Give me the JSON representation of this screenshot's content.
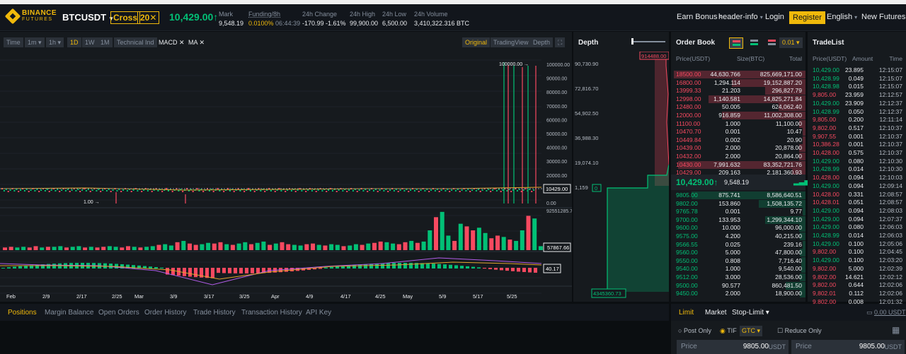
{
  "header": {
    "brand_line1": "BINANCE",
    "brand_line2": "FUTURES",
    "symbol": "BTCUSDT",
    "margin_mode": "Cross",
    "leverage": "20✕",
    "last_price": "10,429.00↑",
    "mark_label": "Mark",
    "mark_value": "9,548.19",
    "funding_label": "Funding/8h",
    "funding_rate": "0.0100%",
    "funding_countdown": "06:44:39",
    "change_label": "24h Change",
    "change_value": "-170.99 -1.61%",
    "high_label": "24h High",
    "high_value": "99,900.00",
    "low_label": "24h Low",
    "low_value": "6,500.00",
    "volume_label": "24h Volume",
    "volume_value": "3,410,322.316 BTC",
    "earn_bonus": "Earn Bonus",
    "header_info": "header-info",
    "login": "Login",
    "register": "Register",
    "language": "English",
    "new_futures": "New Futures"
  },
  "chart": {
    "intervals": [
      "Time",
      "1m",
      "1h",
      "1D",
      "1W",
      "1M",
      "Technical Ind",
      "MACD",
      "MA"
    ],
    "selected_interval": "1D",
    "views": [
      "Original",
      "TradingView",
      "Depth"
    ],
    "selected_view": "Original",
    "price_axis": [
      "100000.00",
      "90000.00",
      "80000.00",
      "70000.00",
      "60000.00",
      "50000.00",
      "40000.00",
      "30000.00",
      "20000.00",
      "10000.00",
      "0.00"
    ],
    "max_marker": "100000.00",
    "min_marker": "1.00",
    "current_price_tag": "10429.00",
    "vol_axis_top": "92551285.71",
    "vol_tag": "57867.66",
    "macd_tag": "40.17",
    "x_axis": [
      "Feb",
      "2/9",
      "2/17",
      "2/25",
      "Mar",
      "3/9",
      "3/17",
      "3/25",
      "Apr",
      "4/9",
      "4/17",
      "4/25",
      "May",
      "5/9",
      "5/17",
      "5/25"
    ],
    "colors": {
      "up": "#02c076",
      "down": "#f84960",
      "ma": "#e0a32c",
      "macd": "#b15ce8"
    }
  },
  "chart_data": {
    "type": "bar",
    "series": [
      {
        "name": "Volume",
        "values": [
          4,
          5,
          4,
          5,
          4,
          6,
          4,
          5,
          5,
          6,
          4,
          5,
          6,
          4,
          5,
          4,
          5,
          6,
          5,
          4,
          6,
          5,
          4,
          5,
          6,
          8,
          9,
          7,
          12,
          14,
          10,
          8,
          9,
          11,
          10,
          12,
          9,
          8,
          10,
          12,
          9,
          11,
          13,
          8,
          10,
          12,
          9,
          8,
          7,
          9,
          10,
          8,
          7,
          9,
          8,
          6,
          7,
          9,
          8,
          10,
          11,
          13,
          12,
          10,
          9,
          12,
          14,
          11,
          13,
          30,
          50,
          58,
          22,
          14,
          40,
          36,
          30,
          34,
          26,
          18,
          22,
          20,
          16,
          14,
          30,
          52,
          48,
          6
        ]
      }
    ]
  },
  "depth": {
    "title": "Depth",
    "axis": [
      "90,730.90",
      "72,816.70",
      "54,902.50",
      "36,988.30",
      "19,074.10",
      "1,159"
    ],
    "ask_tag": "914488.00",
    "bid_tag": "4345360.73"
  },
  "orderbook": {
    "title": "Order Book",
    "precision": "0.01",
    "headers": [
      "Price(USDT)",
      "Size(BTC)",
      "Total"
    ],
    "asks": [
      [
        "18500.00",
        "44,630.766",
        "825,669,171.00",
        0.98
      ],
      [
        "16800.00",
        "1,294.114",
        "19,152,887.20",
        0.55
      ],
      [
        "13999.33",
        "21.203",
        "296,827.79",
        0.3
      ],
      [
        "12998.00",
        "1,140.581",
        "14,825,271.84",
        0.72
      ],
      [
        "12480.00",
        "50.005",
        "624,062.40",
        0.2
      ],
      [
        "12000.00",
        "916.859",
        "11,002,308.00",
        0.62
      ],
      [
        "11100.00",
        "1.000",
        "11,100.00",
        0.05
      ],
      [
        "10470.70",
        "0.001",
        "10.47",
        0.02
      ],
      [
        "10449.84",
        "0.002",
        "20.90",
        0.02
      ],
      [
        "10439.00",
        "2.000",
        "20,878.00",
        0.05
      ],
      [
        "10432.00",
        "2.000",
        "20,864.00",
        0.05
      ],
      [
        "10430.00",
        "7,991.632",
        "83,352,721.76",
        0.95
      ],
      [
        "10429.00",
        "209.163",
        "2,181,360.93",
        0.1
      ]
    ],
    "mid_price": "10,429.00↑",
    "mid_mark": "9,548.19",
    "bids": [
      [
        "9805.00",
        "875.741",
        "8,586,640.51",
        0.85
      ],
      [
        "9802.00",
        "153.860",
        "1,508,135.72",
        0.35
      ],
      [
        "9765.78",
        "0.001",
        "9.77",
        0.02
      ],
      [
        "9700.00",
        "133.953",
        "1,299,344.10",
        0.3
      ],
      [
        "9600.00",
        "10.000",
        "96,000.00",
        0.05
      ],
      [
        "9575.00",
        "4.200",
        "40,215.00",
        0.04
      ],
      [
        "9566.55",
        "0.025",
        "239.16",
        0.02
      ],
      [
        "9560.00",
        "5.000",
        "47,800.00",
        0.04
      ],
      [
        "9550.00",
        "0.808",
        "7,716.40",
        0.03
      ],
      [
        "9540.00",
        "1.000",
        "9,540.00",
        0.03
      ],
      [
        "9512.00",
        "3.000",
        "28,536.00",
        0.04
      ],
      [
        "9500.00",
        "90.577",
        "860,481.50",
        0.15
      ],
      [
        "9450.00",
        "2.000",
        "18,900.00",
        0.04
      ]
    ]
  },
  "tradelist": {
    "title": "TradeList",
    "headers": [
      "Price(USDT)",
      "Amount",
      "Time"
    ],
    "trades": [
      [
        "10,429.00",
        "23.895",
        "12:15:07",
        "g"
      ],
      [
        "10,428.99",
        "0.049",
        "12:15:07",
        "g"
      ],
      [
        "10,428.98",
        "0.015",
        "12:15:07",
        "g"
      ],
      [
        "9,805.00",
        "23.959",
        "12:12:57",
        "r"
      ],
      [
        "10,429.00",
        "23.909",
        "12:12:37",
        "g"
      ],
      [
        "10,428.99",
        "0.050",
        "12:12:37",
        "g"
      ],
      [
        "9,805.00",
        "0.200",
        "12:11:14",
        "r"
      ],
      [
        "9,802.00",
        "0.517",
        "12:10:37",
        "r"
      ],
      [
        "9,907.55",
        "0.001",
        "12:10:37",
        "r"
      ],
      [
        "10,386.28",
        "0.001",
        "12:10:37",
        "r"
      ],
      [
        "10,428.00",
        "0.575",
        "12:10:37",
        "r"
      ],
      [
        "10,429.00",
        "0.080",
        "12:10:30",
        "g"
      ],
      [
        "10,428.99",
        "0.014",
        "12:10:30",
        "g"
      ],
      [
        "10,428.00",
        "0.094",
        "12:10:03",
        "r"
      ],
      [
        "10,429.00",
        "0.094",
        "12:09:14",
        "g"
      ],
      [
        "10,428.00",
        "0.331",
        "12:08:57",
        "r"
      ],
      [
        "10,428.01",
        "0.051",
        "12:08:57",
        "r"
      ],
      [
        "10,429.00",
        "0.094",
        "12:08:03",
        "g"
      ],
      [
        "10,429.00",
        "0.094",
        "12:07:37",
        "g"
      ],
      [
        "10,429.00",
        "0.080",
        "12:06:03",
        "g"
      ],
      [
        "10,428.99",
        "0.014",
        "12:06:03",
        "g"
      ],
      [
        "10,429.00",
        "0.100",
        "12:05:06",
        "g"
      ],
      [
        "9,802.00",
        "0.100",
        "12:04:45",
        "r"
      ],
      [
        "10,429.00",
        "0.100",
        "12:03:20",
        "g"
      ],
      [
        "9,802.00",
        "5.000",
        "12:02:39",
        "r"
      ],
      [
        "9,802.00",
        "14.621",
        "12:02:12",
        "r"
      ],
      [
        "9,802.00",
        "0.644",
        "12:02:06",
        "r"
      ],
      [
        "9,802.01",
        "0.112",
        "12:02:06",
        "r"
      ],
      [
        "9,802.00",
        "0.008",
        "12:01:32",
        "r"
      ]
    ]
  },
  "bottom_tabs": [
    "Positions",
    "Margin Balance",
    "Open Orders",
    "Order History",
    "Trade History",
    "Transaction History",
    "API Key"
  ],
  "order_form": {
    "types": [
      "Limit",
      "Market",
      "Stop-Limit"
    ],
    "balance": "0.00 USDT",
    "post_only": "Post Only",
    "tif": "TIF",
    "tif_value": "GTC",
    "reduce_only": "Reduce Only",
    "buy_price_label": "Price",
    "buy_price": "9805.00",
    "buy_unit": "USDT",
    "sell_price_label": "Price",
    "sell_price": "9805.00",
    "sell_unit": "USDT"
  }
}
